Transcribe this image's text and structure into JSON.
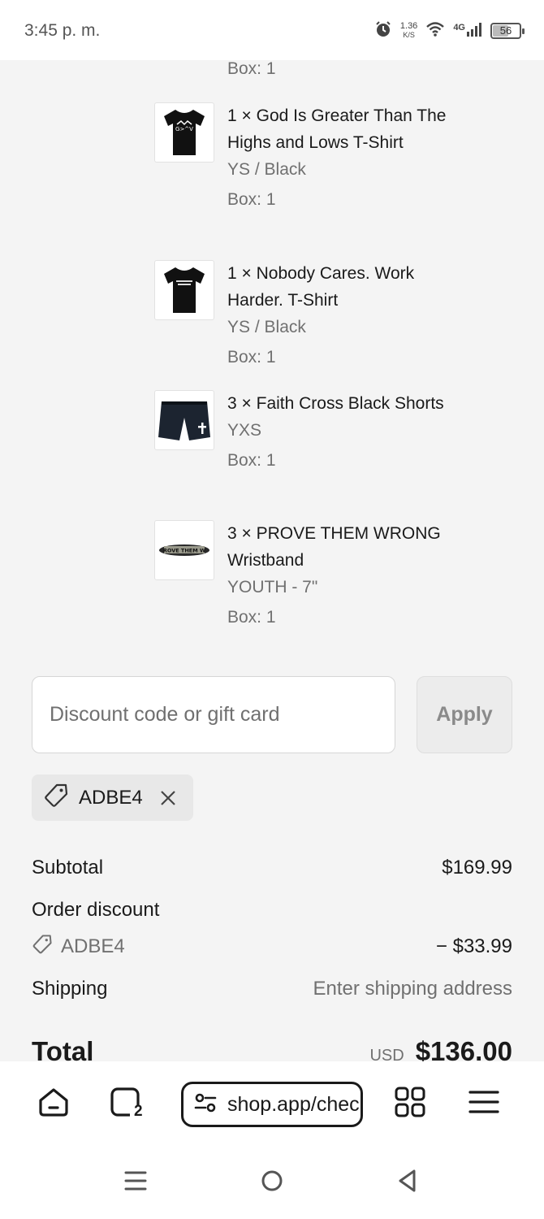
{
  "status_bar": {
    "time": "3:45 p. m.",
    "net_speed_value": "1.36",
    "net_speed_unit": "K/S",
    "network_type": "4G",
    "battery": "56"
  },
  "order_items": {
    "top_box_label": "Box: 1",
    "items": [
      {
        "title": "1 × God Is Greater Than The Highs and Lows T-Shirt",
        "variant": "YS / Black",
        "box": "Box: 1",
        "icon": "tshirt-icon"
      },
      {
        "title": "1 × Nobody Cares. Work Harder. T-Shirt",
        "variant": "YS / Black",
        "box": "Box: 1",
        "icon": "tshirt-icon"
      },
      {
        "title": "3 × Faith Cross Black Shorts",
        "variant": "YXS",
        "box": "Box: 1",
        "icon": "shorts-icon"
      },
      {
        "title": "3 × PROVE THEM WRONG Wristband",
        "variant": "YOUTH - 7\"",
        "box": "Box: 1",
        "icon": "wristband-icon"
      }
    ]
  },
  "discount": {
    "placeholder": "Discount code or gift card",
    "apply_label": "Apply",
    "applied_code": "ADBE4"
  },
  "summary": {
    "subtotal_label": "Subtotal",
    "subtotal_value": "$169.99",
    "order_discount_label": "Order discount",
    "discount_code": "ADBE4",
    "discount_value": "− $33.99",
    "shipping_label": "Shipping",
    "shipping_value": "Enter shipping address",
    "total_label": "Total",
    "currency": "USD",
    "total_value": "$136.00"
  },
  "browser": {
    "tab_count": "2",
    "url": "shop.app/checkout"
  },
  "colors": {
    "background": "#f4f4f4",
    "text": "#1a1a1a",
    "muted_text": "#707070"
  }
}
